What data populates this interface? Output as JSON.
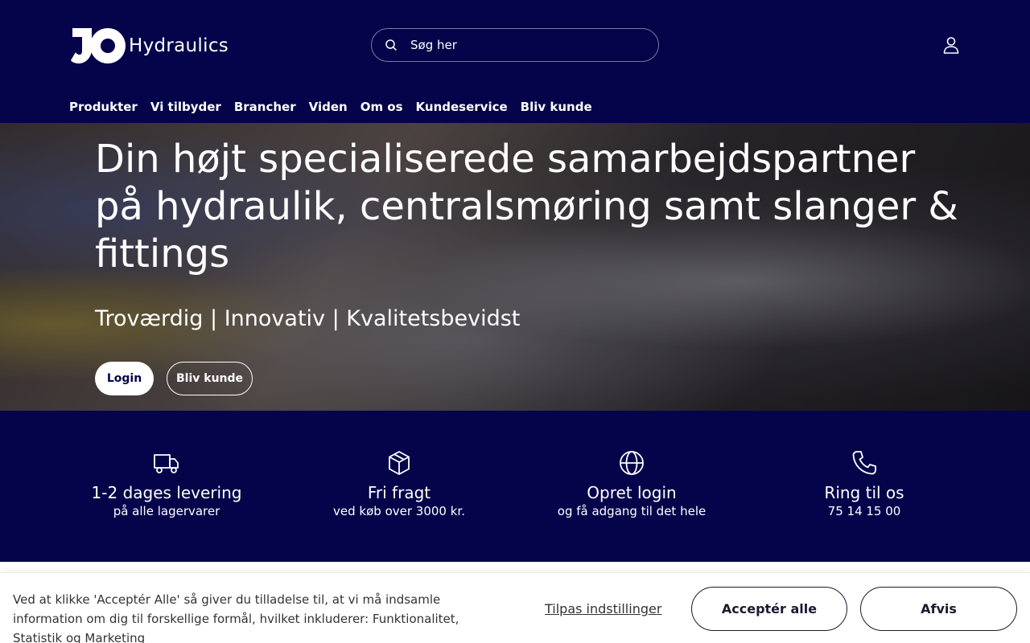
{
  "header": {
    "logo_text": "Hydraulics",
    "logo_mark": "JO",
    "search_placeholder": "Søg her",
    "account_icon": "user-icon"
  },
  "nav": {
    "items": [
      "Produkter",
      "Vi tilbyder",
      "Brancher",
      "Viden",
      "Om os",
      "Kundeservice",
      "Bliv kunde"
    ]
  },
  "hero": {
    "title": "Din højt specialiserede samarbejdspartner på hydraulik, centralsmøring samt slanger & fittings",
    "subtitle": "Troværdig | Innovativ | Kvalitetsbevidst",
    "login_label": "Login",
    "become_label": "Bliv kunde"
  },
  "features": [
    {
      "icon": "truck-icon",
      "title": "1-2 dages levering",
      "sub": "på alle lagervarer"
    },
    {
      "icon": "box-icon",
      "title": "Fri fragt",
      "sub": "ved køb over 3000 kr."
    },
    {
      "icon": "globe-icon",
      "title": "Opret login",
      "sub": "og få adgang til det hele"
    },
    {
      "icon": "phone-icon",
      "title": "Ring til os",
      "sub": "75 14 15 00"
    }
  ],
  "cookie": {
    "text": "Ved at klikke 'Acceptér Alle' så giver du tilladelse til, at vi må indsamle information om dig til forskellige formål, hvilket inkluderer: Funktionalitet, Statistik og Marketing",
    "settings_label": "Tilpas indstillinger",
    "accept_label": "Acceptér alle",
    "reject_label": "Afvis"
  },
  "colors": {
    "brand_navy": "#05044a",
    "white": "#ffffff"
  }
}
